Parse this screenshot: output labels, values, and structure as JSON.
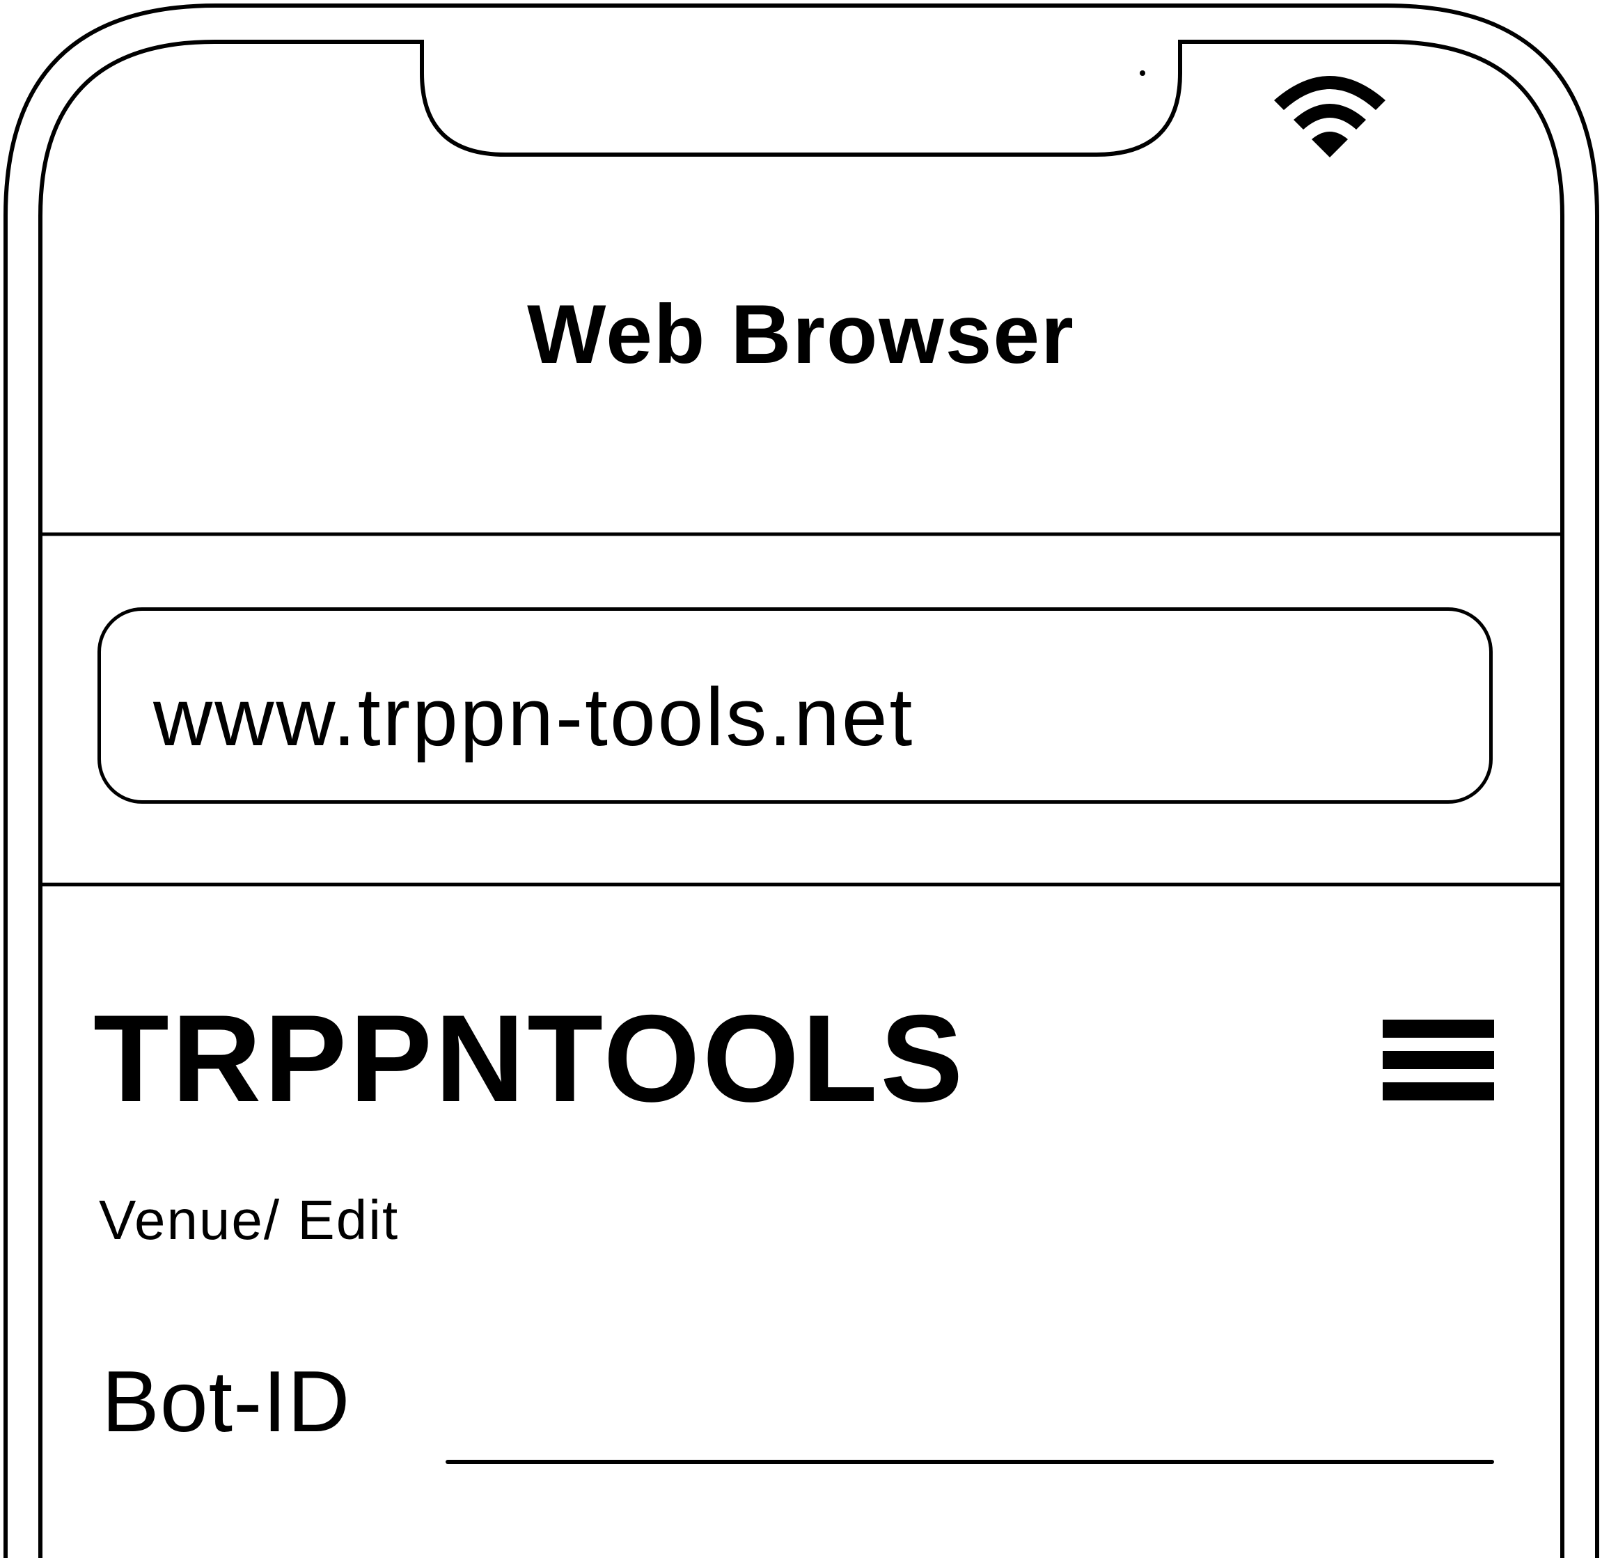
{
  "browser": {
    "title": "Web Browser",
    "url": "www.trppn-tools.net"
  },
  "status_bar": {
    "wifi_icon": "wifi-icon"
  },
  "site": {
    "brand": "TRPPNTOOLS",
    "menu_icon": "hamburger-menu-icon",
    "breadcrumb": "Venue/ Edit"
  },
  "form": {
    "field_label": "Bot-ID",
    "field_value": ""
  }
}
